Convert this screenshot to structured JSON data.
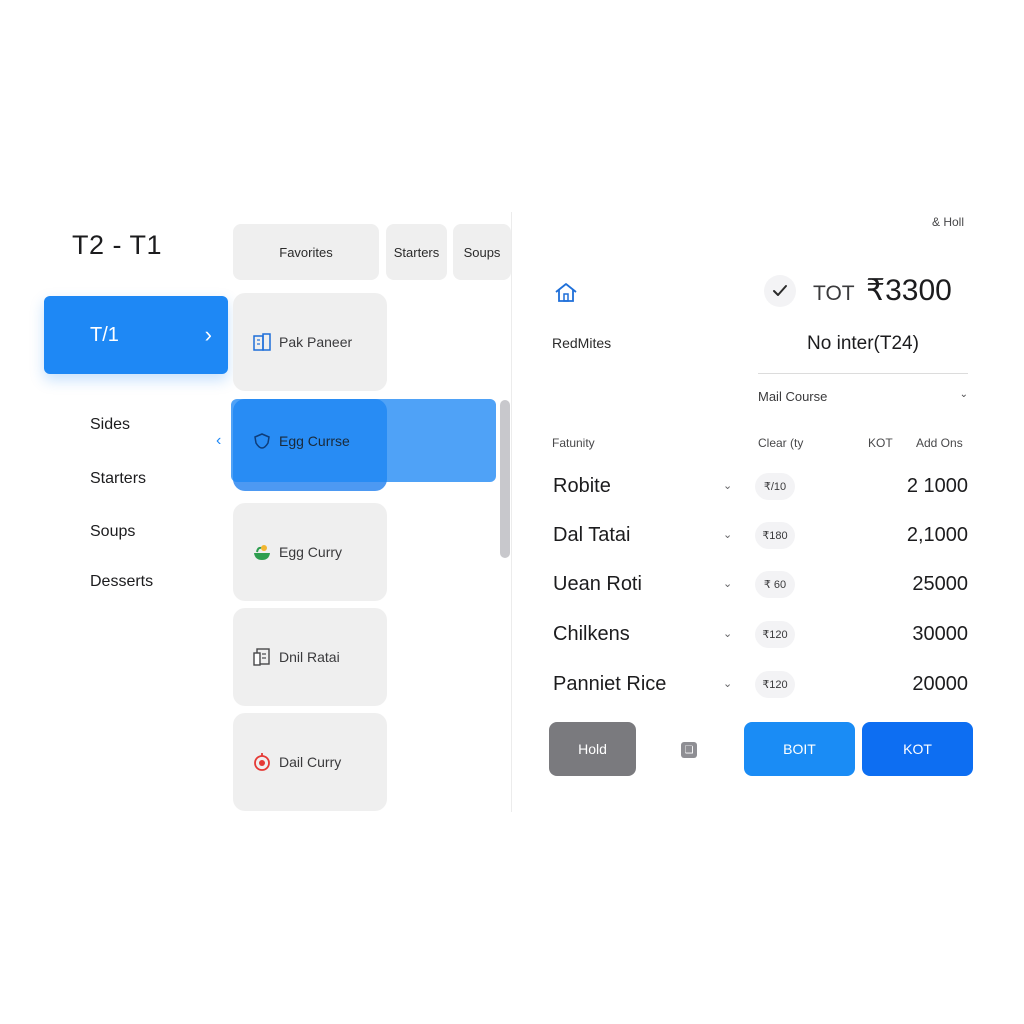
{
  "left": {
    "title": "T2 - T1",
    "active_table": "T/1",
    "categories": [
      "Sides",
      "Starters",
      "Soups",
      "Desserts"
    ]
  },
  "tabs": [
    "Favorites",
    "Starters",
    "Soups"
  ],
  "items": [
    {
      "name": "Pak Paneer",
      "icon": "building-icon"
    },
    {
      "name": "Egg Currse",
      "icon": "shield-icon",
      "selected": true
    },
    {
      "name": "Egg Curry",
      "icon": "leaf-bowl-icon"
    },
    {
      "name": "Dnil Ratai",
      "icon": "document-icon"
    },
    {
      "name": "Dail Curry",
      "icon": "timer-icon"
    }
  ],
  "order": {
    "hold_link": "& Holl",
    "total_label": "TOT",
    "total_value": "₹3300",
    "customer": "RedMites",
    "order_info": "No inter(T24)",
    "course": "Mail Course",
    "columns": {
      "item": "Fatunity",
      "clear": "Clear (ty",
      "kot": "KOT",
      "addons": "Add Ons"
    },
    "rows": [
      {
        "name": "Robite",
        "price": "₹/10",
        "amount": "2 1000"
      },
      {
        "name": "Dal Tatai",
        "price": "₹180",
        "amount": "2,1000"
      },
      {
        "name": "Uean Roti",
        "price": "₹ 60",
        "amount": "25000"
      },
      {
        "name": "Chilkens",
        "price": "₹120",
        "amount": "30000"
      },
      {
        "name": "Panniet Rice",
        "price": "₹120",
        "amount": "20000"
      }
    ],
    "buttons": {
      "hold": "Hold",
      "boit": "BOIT",
      "kot": "KOT"
    }
  },
  "colors": {
    "accent": "#1e88f5",
    "hold_button": "#7a7a7e",
    "kot_button": "#0d6ef2"
  }
}
